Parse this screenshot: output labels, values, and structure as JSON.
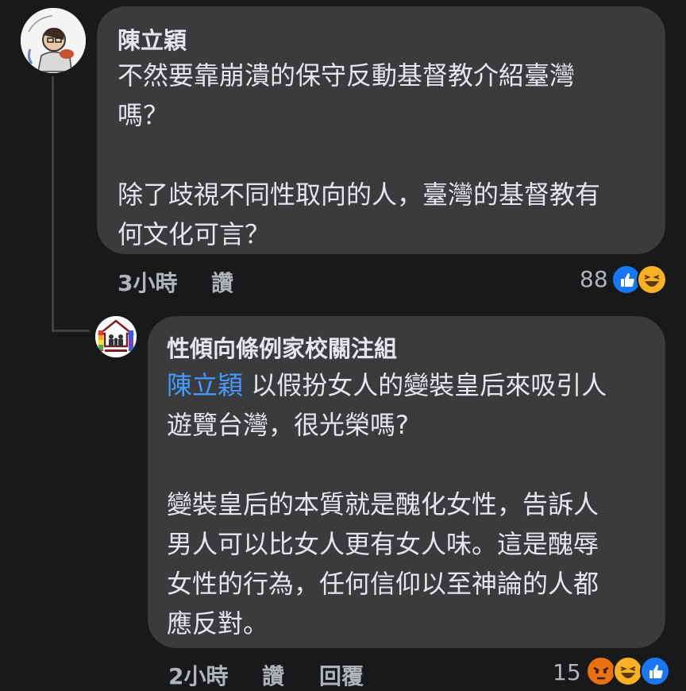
{
  "comment_1": {
    "author": "陳立穎",
    "lines_a": [
      "不然要靠崩潰的保守反動基督教介紹臺灣",
      "嗎？"
    ],
    "lines_b": [
      "除了歧視不同性取向的人，臺灣的基督教有",
      "何文化可言？"
    ],
    "time": "3小時",
    "like_label": "讚",
    "reaction_count": "88",
    "reaction_icons": [
      "like-icon",
      "haha-icon"
    ]
  },
  "comment_2": {
    "author": "性傾向條例家校關注組",
    "mention": "陳立穎",
    "line_1_rest": " 以假扮女人的變裝皇后來吸引人",
    "line_2": "遊覽台灣，很光榮嗎?",
    "lines_b": [
      "變裝皇后的本質就是醜化女性，告訴人",
      "男人可以比女人更有女人味。這是醜辱",
      "女性的行為，任何信仰以至神論的人都",
      "應反對。"
    ],
    "time": "2小時",
    "like_label": "讚",
    "reply_label": "回覆",
    "reaction_count": "15",
    "reaction_icons": [
      "angry-icon",
      "haha-icon",
      "like-icon"
    ]
  },
  "colors": {
    "background": "#18191a",
    "bubble": "#3a3b3c",
    "text": "#e4e6eb",
    "meta": "#b0b3b8",
    "mention": "#4599ff",
    "like": "#1877f2",
    "haha": "#f7b125",
    "angry": "#e9710f"
  }
}
